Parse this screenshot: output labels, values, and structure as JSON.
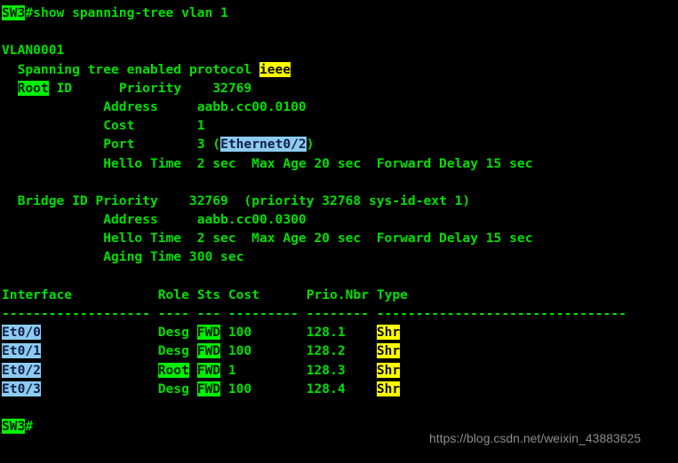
{
  "terminal": {
    "device": "SW3",
    "prompt_symbol": "#",
    "command": "show spanning-tree vlan 1",
    "bottom_prompt_device": "SW3",
    "bottom_prompt_symbol": "#",
    "colors": {
      "background": "#000000",
      "foreground": "#00e000",
      "highlight_green_bg": "#00f000",
      "highlight_yellow_bg": "#ffff00",
      "highlight_blue_bg": "#8ecbf0",
      "watermark": "#8c8c8c"
    }
  },
  "output": {
    "vlan_name": "VLAN0001",
    "spanning_tree_line": {
      "prefix": "  Spanning tree enabled protocol ",
      "protocol": "ieee"
    },
    "root_id": {
      "label_highlight": "Root",
      "label_rest": " ID",
      "priority_label": "Priority",
      "priority_value": "32769",
      "address_label": "Address",
      "address_value": "aabb.cc00.0100",
      "cost_label": "Cost",
      "cost_value": "1",
      "port_label": "Port",
      "port_number": "3",
      "port_interface": "Ethernet0/2",
      "hello_label": "Hello Time",
      "hello_value": "  2 sec  Max Age 20 sec  Forward Delay 15 sec"
    },
    "bridge_id": {
      "label": "  Bridge ID",
      "priority_label": "Priority",
      "priority_value": "32769  (priority 32768 sys-id-ext 1)",
      "address_label": "Address",
      "address_value": "aabb.cc00.0300",
      "hello_label": "Hello Time",
      "hello_value": "  2 sec  Max Age 20 sec  Forward Delay 15 sec",
      "aging_label": "Aging Time",
      "aging_value": "300 sec"
    },
    "table": {
      "headers": [
        "Interface",
        "Role",
        "Sts",
        "Cost",
        "Prio.Nbr",
        "Type"
      ],
      "separator": "------------------- ---- --- --------- -------- --------------------------------",
      "rows": [
        {
          "interface": "Et0/0",
          "role": "Desg",
          "sts": "FWD",
          "cost": "100",
          "prio_nbr": "128.1",
          "type": "Shr",
          "role_highlighted": false
        },
        {
          "interface": "Et0/1",
          "role": "Desg",
          "sts": "FWD",
          "cost": "100",
          "prio_nbr": "128.2",
          "type": "Shr",
          "role_highlighted": false
        },
        {
          "interface": "Et0/2",
          "role": "Root",
          "sts": "FWD",
          "cost": "1",
          "prio_nbr": "128.3",
          "type": "Shr",
          "role_highlighted": true
        },
        {
          "interface": "Et0/3",
          "role": "Desg",
          "sts": "FWD",
          "cost": "100",
          "prio_nbr": "128.4",
          "type": "Shr",
          "role_highlighted": false
        }
      ]
    }
  },
  "watermark": {
    "text": "https://blog.csdn.net/weixin_43883625"
  }
}
